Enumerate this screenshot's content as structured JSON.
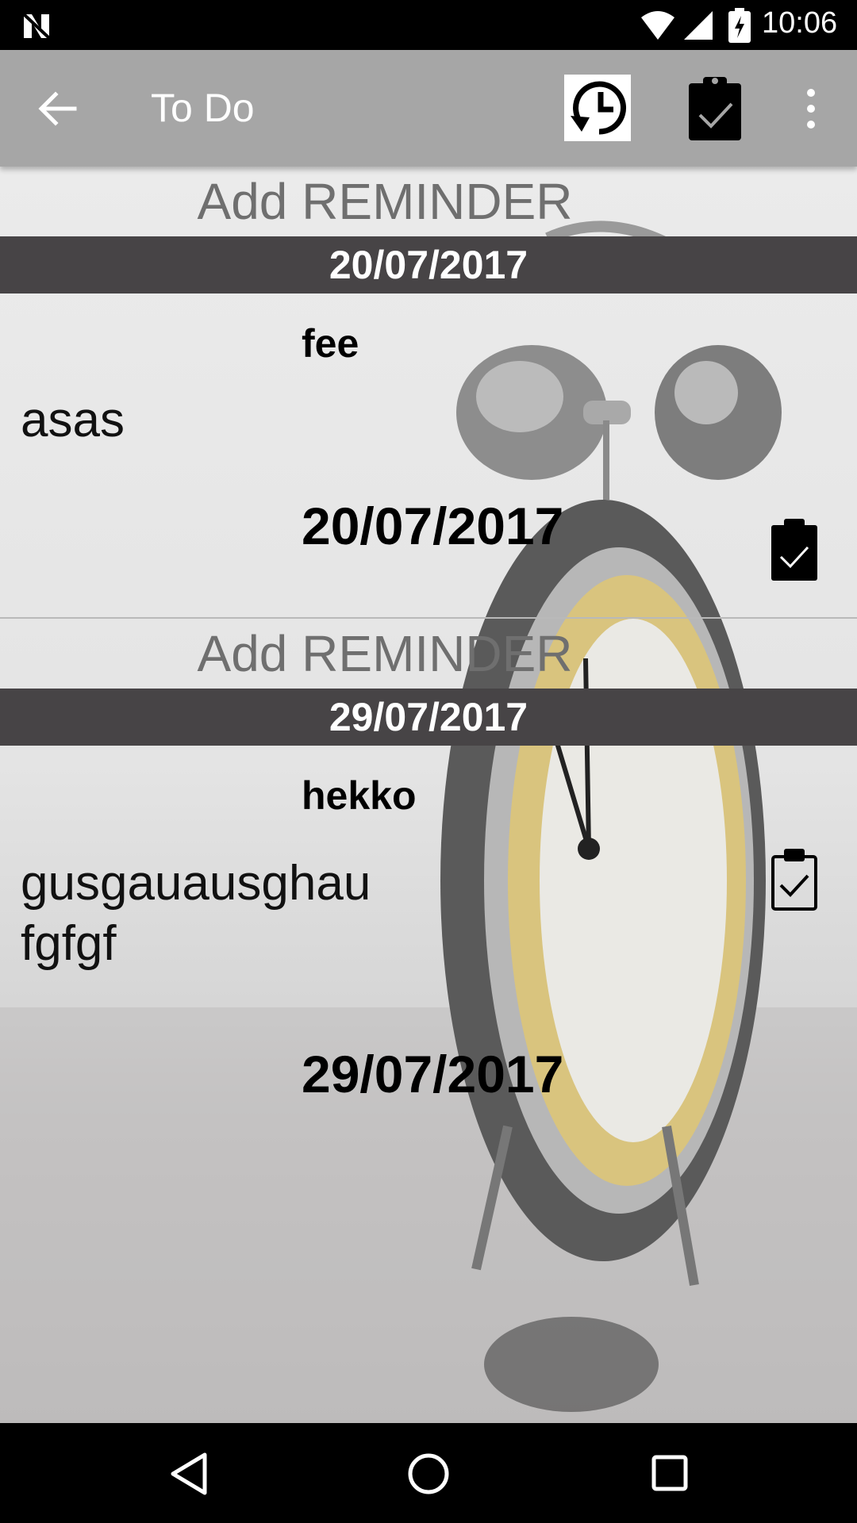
{
  "status_bar": {
    "time": "10:06"
  },
  "toolbar": {
    "title": "To Do"
  },
  "reminders": [
    {
      "add_label": "Add REMINDER",
      "date_header": "20/07/2017",
      "title": "fee",
      "body": "asas",
      "date": "20/07/2017",
      "done": true
    },
    {
      "add_label": "Add REMINDER",
      "date_header": "29/07/2017",
      "title": "hekko",
      "body": "gusgauausghau\nfgfgf",
      "date": "29/07/2017",
      "done": false
    }
  ],
  "colors": {
    "toolbar": "#a6a6a6",
    "date_header": "#474446",
    "status_bar": "#000000"
  },
  "icons": [
    "back-arrow-icon",
    "history-clock-icon",
    "clipboard-check-icon",
    "overflow-menu-icon",
    "nav-back-icon",
    "nav-home-icon",
    "nav-recents-icon"
  ]
}
